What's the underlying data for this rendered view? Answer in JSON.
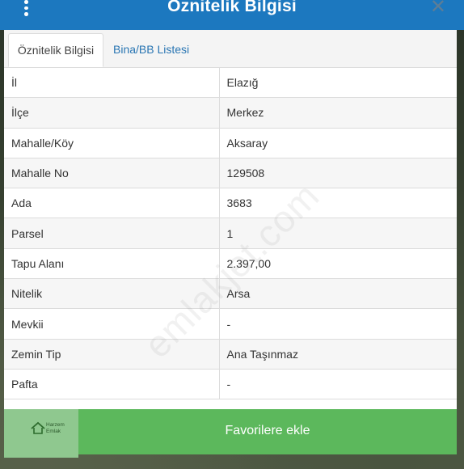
{
  "header": {
    "title": "Öznitelik Bilgisi",
    "close_glyph": "✕"
  },
  "tabs": [
    {
      "label": "Öznitelik Bilgisi",
      "active": true
    },
    {
      "label": "Bina/BB Listesi",
      "active": false
    }
  ],
  "rows": [
    {
      "key": "İl",
      "value": "Elazığ"
    },
    {
      "key": "İlçe",
      "value": "Merkez"
    },
    {
      "key": "Mahalle/Köy",
      "value": "Aksaray"
    },
    {
      "key": "Mahalle No",
      "value": "129508"
    },
    {
      "key": "Ada",
      "value": "3683"
    },
    {
      "key": "Parsel",
      "value": "1"
    },
    {
      "key": "Tapu Alanı",
      "value": "2.397,00"
    },
    {
      "key": "Nitelik",
      "value": "Arsa"
    },
    {
      "key": "Mevkii",
      "value": "-"
    },
    {
      "key": "Zemin Tip",
      "value": "Ana Taşınmaz"
    },
    {
      "key": "Pafta",
      "value": "-"
    }
  ],
  "favorite_button": {
    "label": "Favorilere ekle"
  },
  "logo": {
    "line1": "Harzem",
    "line2": "Emlak"
  },
  "watermark": "emlakjet.com",
  "colors": {
    "header": "#1c78bf",
    "button": "#5cb85c",
    "link": "#2a76b3"
  }
}
